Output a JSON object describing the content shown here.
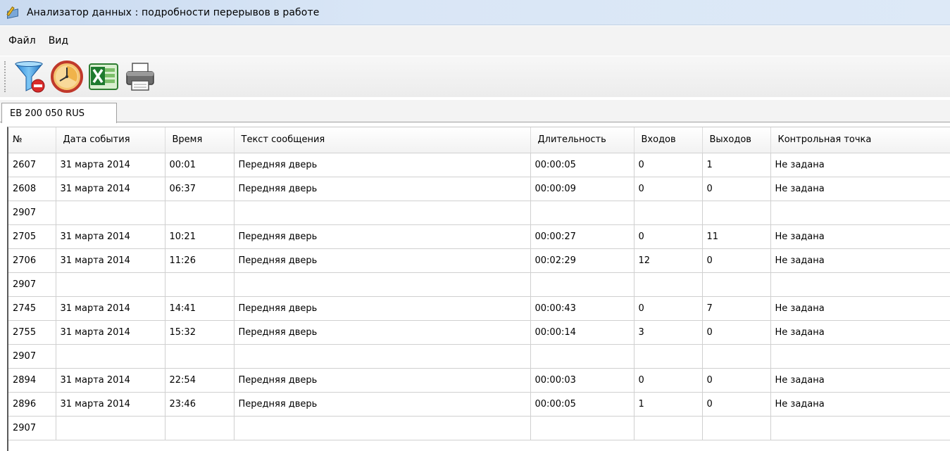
{
  "window": {
    "title": "Анализатор данных : подробности перерывов в работе",
    "icon": "notepad-pencil-icon"
  },
  "menu": [
    {
      "label": "Файл"
    },
    {
      "label": "Вид"
    }
  ],
  "toolbar": [
    {
      "icon": "filter-remove-icon"
    },
    {
      "icon": "clock-icon"
    },
    {
      "icon": "excel-export-icon"
    },
    {
      "icon": "printer-icon"
    }
  ],
  "tab": {
    "label": "EB 200 050 RUS"
  },
  "table": {
    "columns": [
      "№",
      "Дата события",
      "Время",
      "Текст сообщения",
      "Длительность",
      "Входов",
      "Выходов",
      "Контрольная точка"
    ],
    "rows": [
      [
        "2607",
        "31 марта 2014",
        "00:01",
        "Передняя дверь",
        "00:00:05",
        "0",
        "1",
        "Не задана"
      ],
      [
        "2608",
        "31 марта 2014",
        "06:37",
        "Передняя дверь",
        "00:00:09",
        "0",
        "0",
        "Не задана"
      ],
      [
        "2907",
        "",
        "",
        "",
        "",
        "",
        "",
        ""
      ],
      [
        "2705",
        "31 марта 2014",
        "10:21",
        "Передняя дверь",
        "00:00:27",
        "0",
        "11",
        "Не задана"
      ],
      [
        "2706",
        "31 марта 2014",
        "11:26",
        "Передняя дверь",
        "00:02:29",
        "12",
        "0",
        "Не задана"
      ],
      [
        "2907",
        "",
        "",
        "",
        "",
        "",
        "",
        ""
      ],
      [
        "2745",
        "31 марта 2014",
        "14:41",
        "Передняя дверь",
        "00:00:43",
        "0",
        "7",
        "Не задана"
      ],
      [
        "2755",
        "31 марта 2014",
        "15:32",
        "Передняя дверь",
        "00:00:14",
        "3",
        "0",
        "Не задана"
      ],
      [
        "2907",
        "",
        "",
        "",
        "",
        "",
        "",
        ""
      ],
      [
        "2894",
        "31 марта 2014",
        "22:54",
        "Передняя дверь",
        "00:00:03",
        "0",
        "0",
        "Не задана"
      ],
      [
        "2896",
        "31 марта 2014",
        "23:46",
        "Передняя дверь",
        "00:00:05",
        "1",
        "0",
        "Не задана"
      ],
      [
        "2907",
        "",
        "",
        "",
        "",
        "",
        "",
        ""
      ]
    ]
  }
}
